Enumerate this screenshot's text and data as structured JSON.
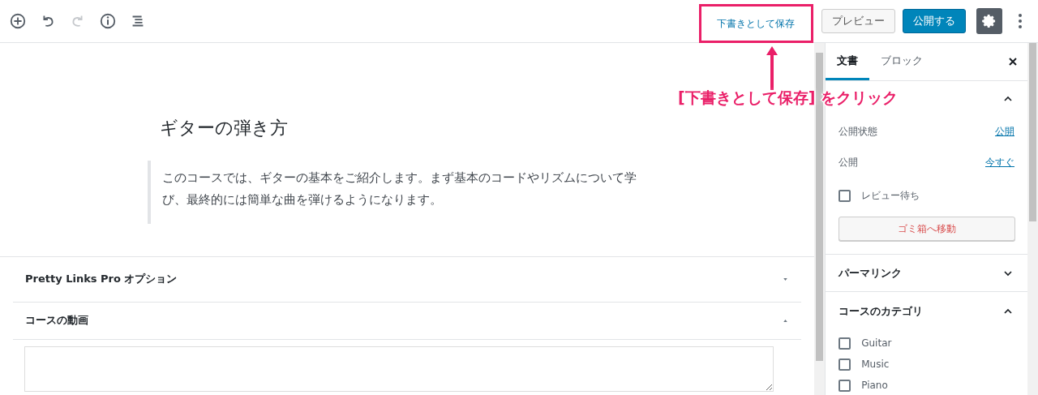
{
  "toolbar": {
    "redo_disabled": true
  },
  "header_actions": {
    "save_draft": "下書きとして保存",
    "preview": "プレビュー",
    "publish": "公開する",
    "settings_on": true
  },
  "editor": {
    "title": "ギターの弾き方",
    "quote": "このコースでは、ギターの基本をご紹介します。まず基本のコードやリズムについて学び、最終的には簡単な曲を弾けるようになります。"
  },
  "meta_boxes": [
    {
      "title": "Pretty Links Pro オプション",
      "expanded": false
    },
    {
      "title": "コースの動画",
      "expanded": true
    }
  ],
  "sidebar": {
    "tabs": [
      {
        "label": "文書",
        "selected": true
      },
      {
        "label": "ブロック",
        "selected": false
      }
    ],
    "status": {
      "expanded": true,
      "rows": [
        {
          "label": "公開状態",
          "value": "公開"
        },
        {
          "label": "公開",
          "value": "今すぐ"
        }
      ],
      "pending": {
        "label": "レビュー待ち",
        "checked": false
      },
      "trash": "ゴミ箱へ移動"
    },
    "panels": [
      {
        "title": "パーマリンク",
        "expanded": false
      },
      {
        "title": "コースのカテゴリ",
        "expanded": true,
        "categories": [
          {
            "label": "Guitar",
            "checked": false
          },
          {
            "label": "Music",
            "checked": false
          },
          {
            "label": "Piano",
            "checked": false
          }
        ]
      }
    ]
  },
  "annotation": {
    "label": "[下書きとして保存] をクリック"
  }
}
